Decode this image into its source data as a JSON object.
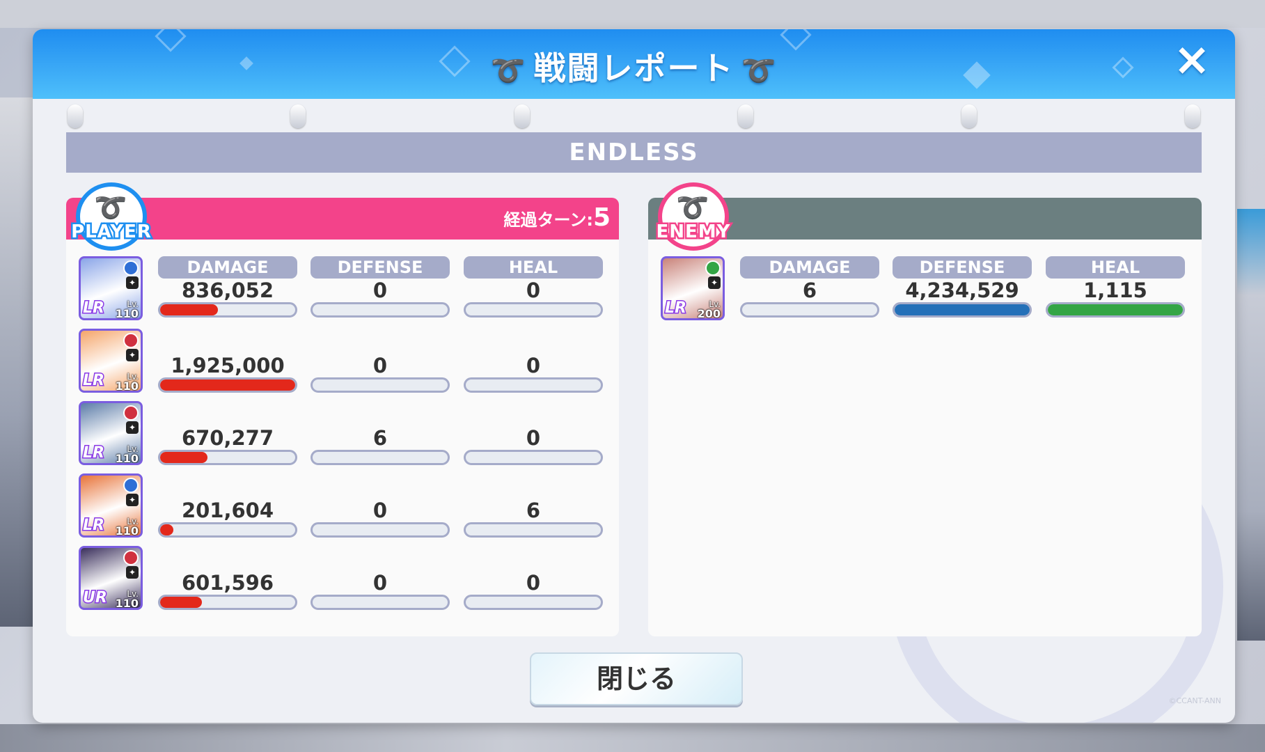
{
  "dialog": {
    "title": "戦闘レポート",
    "mode": "ENDLESS",
    "close_button_label": "閉じる",
    "close_icon": "×",
    "copyright": "©CCANT-ANN"
  },
  "player": {
    "badge": "PLAYER",
    "turns_label": "経過ターン:",
    "turns_value": "5",
    "headers": {
      "damage": "DAMAGE",
      "defense": "DEFENSE",
      "heal": "HEAL"
    },
    "units": [
      {
        "rarity": "LR",
        "level_label": "Lv.",
        "level": "110",
        "damage": "836,052",
        "defense": "0",
        "heal": "0",
        "damage_bar": 0.43,
        "defense_bar": 0,
        "heal_bar": 0,
        "element_color": "#2f6fd6",
        "portrait": "#8aa5e8"
      },
      {
        "rarity": "LR",
        "level_label": "Lv.",
        "level": "110",
        "damage": "1,925,000",
        "defense": "0",
        "heal": "0",
        "damage_bar": 1.0,
        "defense_bar": 0,
        "heal_bar": 0,
        "element_color": "#d0313f",
        "portrait": "#f5a56a"
      },
      {
        "rarity": "LR",
        "level_label": "Lv.",
        "level": "110",
        "damage": "670,277",
        "defense": "6",
        "heal": "0",
        "damage_bar": 0.35,
        "defense_bar": 0,
        "heal_bar": 0,
        "element_color": "#d0313f",
        "portrait": "#5c7ca8"
      },
      {
        "rarity": "LR",
        "level_label": "Lv.",
        "level": "110",
        "damage": "201,604",
        "defense": "0",
        "heal": "6",
        "damage_bar": 0.1,
        "defense_bar": 0,
        "heal_bar": 0,
        "element_color": "#2f6fd6",
        "portrait": "#e8743a"
      },
      {
        "rarity": "UR",
        "level_label": "Lv.",
        "level": "110",
        "damage": "601,596",
        "defense": "0",
        "heal": "0",
        "damage_bar": 0.31,
        "defense_bar": 0,
        "heal_bar": 0,
        "element_color": "#d0313f",
        "portrait": "#3a2f5c"
      }
    ]
  },
  "enemy": {
    "badge": "ENEMY",
    "headers": {
      "damage": "DAMAGE",
      "defense": "DEFENSE",
      "heal": "HEAL"
    },
    "units": [
      {
        "rarity": "LR",
        "level_label": "Lv.",
        "level": "200",
        "damage": "6",
        "defense": "4,234,529",
        "heal": "1,115",
        "damage_bar": 0,
        "defense_bar": 1.0,
        "heal_bar": 1.0,
        "element_color": "#34a545",
        "portrait": "#c9837a"
      }
    ]
  },
  "icons": {
    "wing": "wing-icon",
    "close": "close-icon",
    "element": "element-icon",
    "role": "role-icon"
  },
  "colors": {
    "titlebar": "#2a9cf4",
    "player_header": "#f3438a",
    "enemy_header": "#6b7f80",
    "damage_bar": "#e3281b",
    "defense_bar": "#2470b8",
    "heal_bar": "#34a545",
    "stat_header": "#a5abc9"
  }
}
